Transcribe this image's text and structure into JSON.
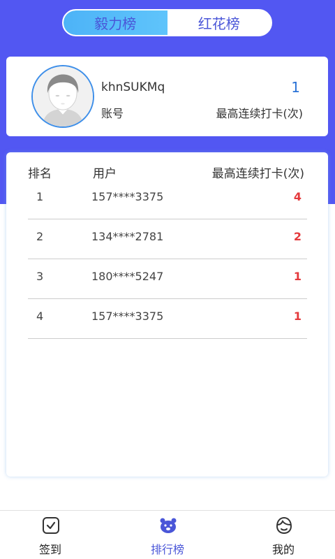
{
  "tabs": [
    {
      "label": "毅力榜",
      "active": true
    },
    {
      "label": "红花榜",
      "active": false
    }
  ],
  "profile": {
    "username": "khnSUKMq",
    "account_label": "账号",
    "count": "1",
    "count_label": "最高连续打卡(次)"
  },
  "ranking": {
    "headers": {
      "rank": "排名",
      "user": "用户",
      "count": "最高连续打卡(次)"
    },
    "rows": [
      {
        "rank": "1",
        "user": "157****3375",
        "count": "4"
      },
      {
        "rank": "2",
        "user": "134****2781",
        "count": "2"
      },
      {
        "rank": "3",
        "user": "180****5247",
        "count": "1"
      },
      {
        "rank": "4",
        "user": "157****3375",
        "count": "1"
      }
    ]
  },
  "nav": {
    "checkin": "签到",
    "ranking": "排行榜",
    "mine": "我的"
  },
  "colors": {
    "hero_bg": "#5257f2",
    "accent": "#4a56d8",
    "count_highlight": "#e4393c",
    "my_count": "#2a72d6"
  },
  "icons": {
    "checkin": "check-square-icon",
    "ranking": "bear-ranking-icon",
    "mine": "user-face-icon"
  }
}
